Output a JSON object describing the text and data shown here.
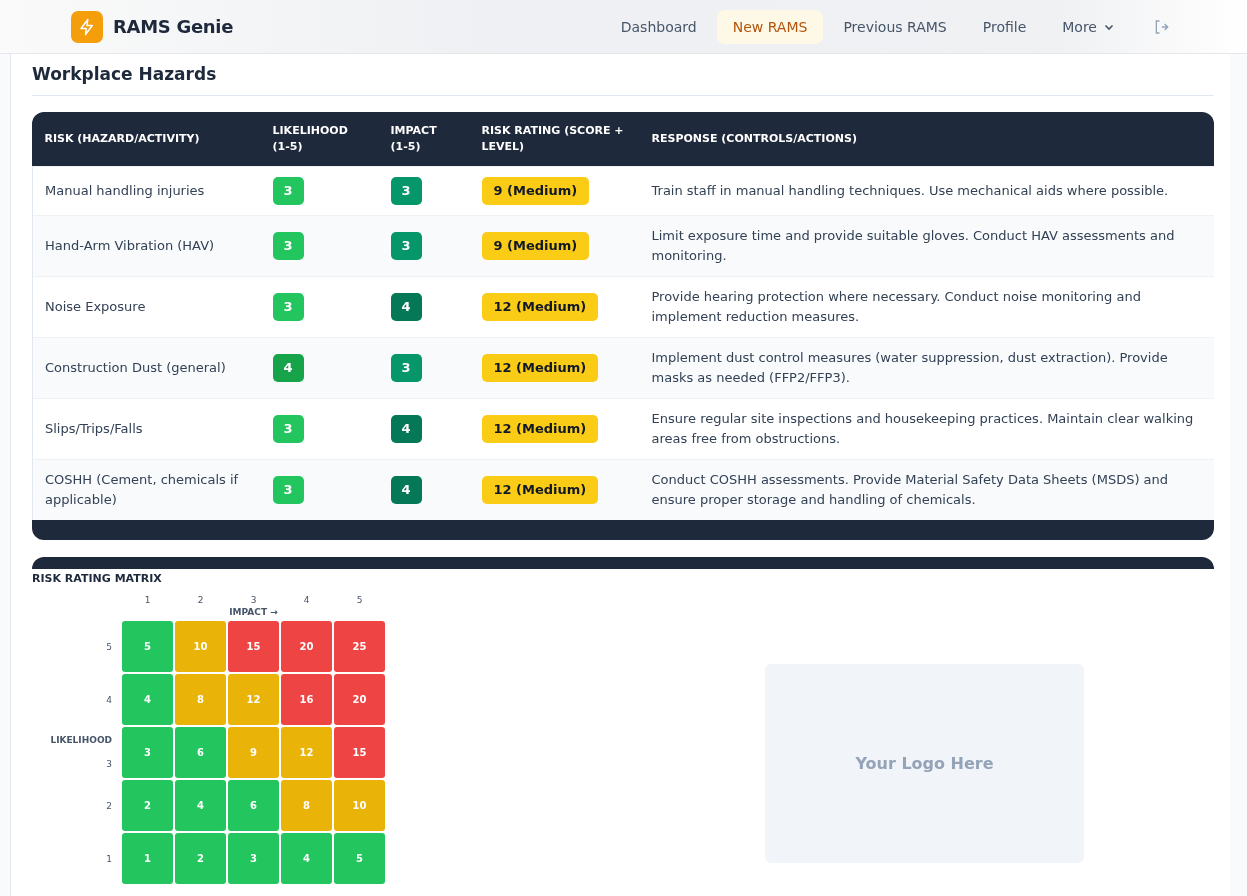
{
  "brand": {
    "name": "RAMS Genie"
  },
  "nav": [
    {
      "label": "Dashboard",
      "selected": false
    },
    {
      "label": "New RAMS",
      "selected": true
    },
    {
      "label": "Previous RAMS",
      "selected": false
    },
    {
      "label": "Profile",
      "selected": false
    },
    {
      "label": "More",
      "selected": false,
      "kind": "dropdown"
    }
  ],
  "section_title": "Workplace Hazards",
  "table": {
    "columns": [
      "RISK (HAZARD/ACTIVITY)",
      "LIKELIHOOD (1-5)",
      "IMPACT (1-5)",
      "RISK RATING (SCORE + LEVEL)",
      "RESPONSE (CONTROLS/ACTIONS)"
    ],
    "rows": [
      {
        "risk": "Manual handling injuries",
        "likelihood": {
          "value": "3",
          "color": "#22c55e"
        },
        "impact": {
          "value": "3",
          "color": "#059669"
        },
        "rating": {
          "value": "9 (Medium)",
          "color": "#facc15"
        },
        "response": "Train staff in manual handling techniques. Use mechanical aids where possible."
      },
      {
        "risk": "Hand-Arm Vibration (HAV)",
        "likelihood": {
          "value": "3",
          "color": "#22c55e"
        },
        "impact": {
          "value": "3",
          "color": "#059669"
        },
        "rating": {
          "value": "9 (Medium)",
          "color": "#facc15"
        },
        "response": "Limit exposure time and provide suitable gloves. Conduct HAV assessments and monitoring."
      },
      {
        "risk": "Noise Exposure",
        "likelihood": {
          "value": "3",
          "color": "#22c55e"
        },
        "impact": {
          "value": "4",
          "color": "#047857"
        },
        "rating": {
          "value": "12 (Medium)",
          "color": "#facc15"
        },
        "response": "Provide hearing protection where necessary. Conduct noise monitoring and implement reduction measures."
      },
      {
        "risk": "Construction Dust (general)",
        "likelihood": {
          "value": "4",
          "color": "#16a34a"
        },
        "impact": {
          "value": "3",
          "color": "#059669"
        },
        "rating": {
          "value": "12 (Medium)",
          "color": "#facc15"
        },
        "response": "Implement dust control measures (water suppression, dust extraction). Provide masks as needed (FFP2/FFP3)."
      },
      {
        "risk": "Slips/Trips/Falls",
        "likelihood": {
          "value": "3",
          "color": "#22c55e"
        },
        "impact": {
          "value": "4",
          "color": "#047857"
        },
        "rating": {
          "value": "12 (Medium)",
          "color": "#facc15"
        },
        "response": "Ensure regular site inspections and housekeeping practices. Maintain clear walking areas free from obstructions."
      },
      {
        "risk": "COSHH (Cement, chemicals if applicable)",
        "likelihood": {
          "value": "3",
          "color": "#22c55e"
        },
        "impact": {
          "value": "4",
          "color": "#047857"
        },
        "rating": {
          "value": "12 (Medium)",
          "color": "#facc15"
        },
        "response": "Conduct COSHH assessments. Provide Material Safety Data Sheets (MSDS) and ensure proper storage and handling of chemicals."
      }
    ]
  },
  "matrix": {
    "title": "RISK RATING MATRIX",
    "impact_label": "IMPACT →",
    "likelihood_label": "LIKELIHOOD",
    "column_labels": [
      "1",
      "2",
      "3",
      "4",
      "5"
    ],
    "rows": [
      {
        "label": "5",
        "cells": [
          {
            "value": "5",
            "color": "#22c55e"
          },
          {
            "value": "10",
            "color": "#eab308"
          },
          {
            "value": "15",
            "color": "#ef4444"
          },
          {
            "value": "20",
            "color": "#ef4444"
          },
          {
            "value": "25",
            "color": "#ef4444"
          }
        ]
      },
      {
        "label": "4",
        "cells": [
          {
            "value": "4",
            "color": "#22c55e"
          },
          {
            "value": "8",
            "color": "#eab308"
          },
          {
            "value": "12",
            "color": "#eab308"
          },
          {
            "value": "16",
            "color": "#ef4444"
          },
          {
            "value": "20",
            "color": "#ef4444"
          }
        ]
      },
      {
        "label": "3",
        "cells": [
          {
            "value": "3",
            "color": "#22c55e"
          },
          {
            "value": "6",
            "color": "#22c55e"
          },
          {
            "value": "9",
            "color": "#eab308"
          },
          {
            "value": "12",
            "color": "#eab308"
          },
          {
            "value": "15",
            "color": "#ef4444"
          }
        ]
      },
      {
        "label": "2",
        "cells": [
          {
            "value": "2",
            "color": "#22c55e"
          },
          {
            "value": "4",
            "color": "#22c55e"
          },
          {
            "value": "6",
            "color": "#22c55e"
          },
          {
            "value": "8",
            "color": "#eab308"
          },
          {
            "value": "10",
            "color": "#eab308"
          }
        ]
      },
      {
        "label": "1",
        "cells": [
          {
            "value": "1",
            "color": "#22c55e"
          },
          {
            "value": "2",
            "color": "#22c55e"
          },
          {
            "value": "3",
            "color": "#22c55e"
          },
          {
            "value": "4",
            "color": "#22c55e"
          },
          {
            "value": "5",
            "color": "#22c55e"
          }
        ]
      }
    ]
  },
  "logo_placeholder": "Your Logo Here"
}
